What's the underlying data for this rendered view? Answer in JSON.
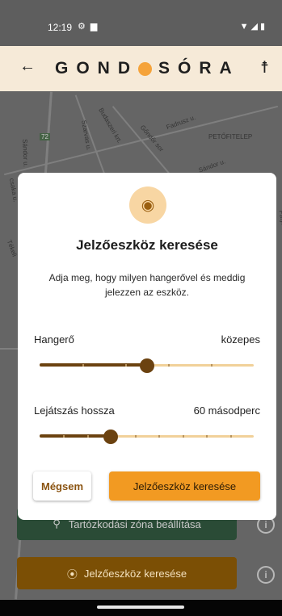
{
  "status_bar": {
    "time": "12:19",
    "left_icons": [
      "settings-icon",
      "clipboard-icon"
    ],
    "right_icons": [
      "wifi-icon",
      "signal-icon",
      "battery-icon"
    ]
  },
  "app_bar": {
    "title_left": "GOND",
    "title_right": "SÓRA",
    "accent_color": "#f5a33a",
    "background": "#f6ead8"
  },
  "map": {
    "labels": [
      "Fadrusz u.",
      "Budaszeri krt.",
      "Szarvas u.",
      "PETŐFITELEP",
      "Gőndőr sor",
      "Sándor u.",
      "Sándor u.",
      "csaka u.",
      "Tékeli",
      "Pátyi u.",
      "72"
    ]
  },
  "background_buttons": {
    "zone_label": "Tartózkodási zóna beállítása",
    "find_label": "Jelzőeszköz keresése",
    "info_glyph": "i"
  },
  "dialog": {
    "title": "Jelzőeszköz keresése",
    "body": "Adja meg, hogy milyen hangerővel és meddig jelezzen az eszköz.",
    "volume": {
      "label": "Hangerő",
      "value_text": "közepes",
      "level": 0.5,
      "steps": 5
    },
    "duration": {
      "label": "Lejátszás hossza",
      "value_text": "60 másodperc",
      "level": 0.333,
      "steps": 9
    },
    "cancel_label": "Mégsem",
    "confirm_label": "Jelzőeszköz keresése"
  },
  "colors": {
    "slider_active": "#6b4210",
    "slider_inactive": "#f1d199",
    "confirm_button": "#f29a22",
    "zone_button": "#2a4b36",
    "find_button": "#7b4f05"
  }
}
